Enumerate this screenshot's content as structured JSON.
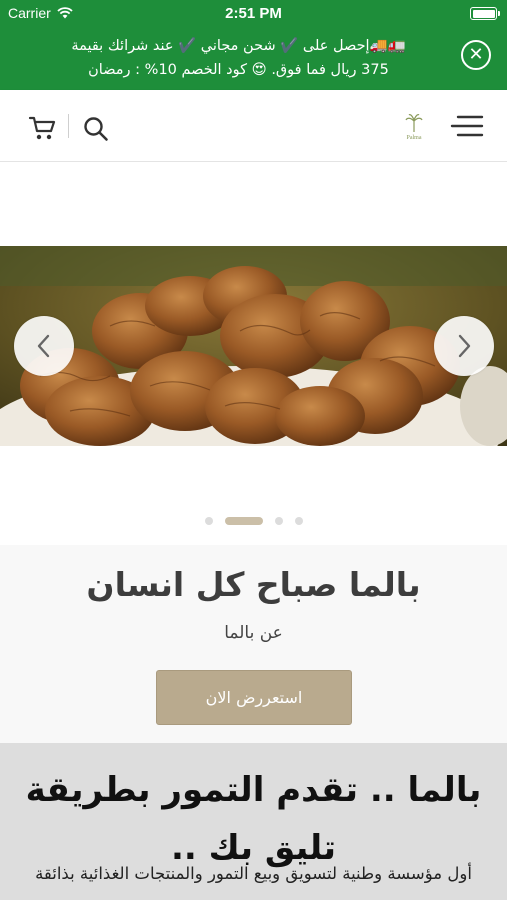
{
  "status_bar": {
    "carrier": "Carrier",
    "time": "2:51 PM"
  },
  "promo": {
    "text_line1": "🚛🚚إحصل على ✔️ شحن مجاني ✔️ عند شرائك بقيمة",
    "text_line2": "375 ريال فما فوق. 😍 كود الخصم 10% : رمضان",
    "close_icon": "close-circle-icon",
    "background": "#1e8e3a"
  },
  "header": {
    "logo_text": "Palma",
    "icons": [
      "cart-icon",
      "search-icon",
      "palm-logo",
      "menu-icon"
    ]
  },
  "slider": {
    "slides_count": 4,
    "active_index": 1,
    "prev_icon": "chevron-left-icon",
    "next_icon": "chevron-right-icon"
  },
  "hero": {
    "title": "بالما صباح كل انسان",
    "subtitle": "عن بالما",
    "button_label": "استعررض الان",
    "button_color": "#b9aa8e"
  },
  "about": {
    "title": "بالما .. تقدم التمور بطريقة تليق بك ..",
    "text": "أول مؤسسة وطنية لتسويق وبيع التمور والمنتجات الغذائية بذائقة"
  }
}
